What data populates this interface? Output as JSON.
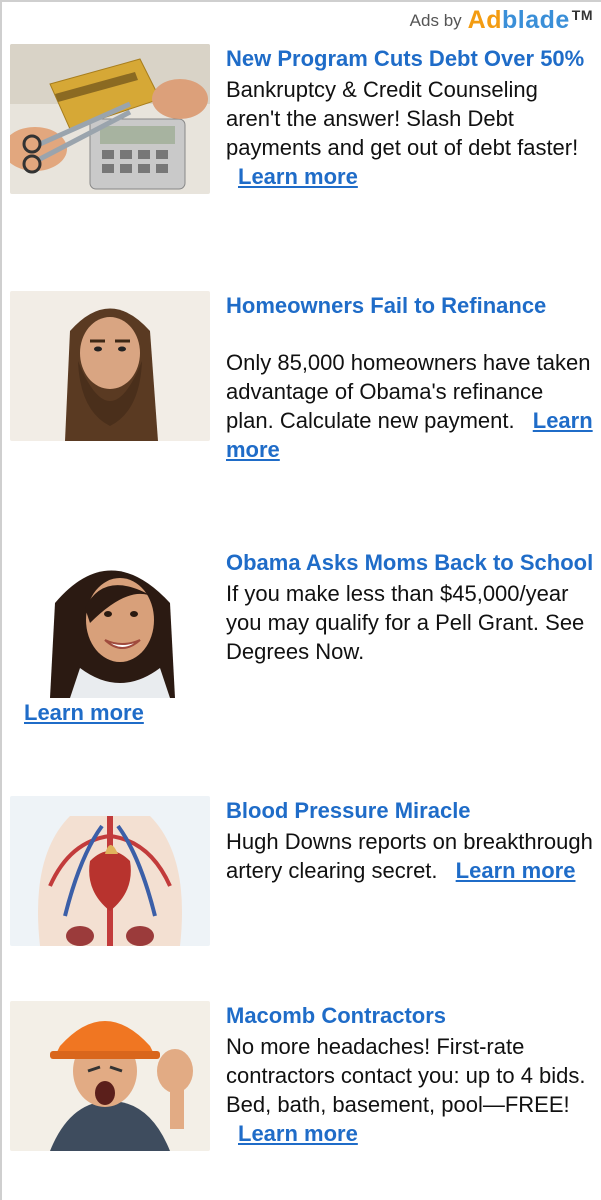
{
  "header": {
    "ads_by": "Ads by",
    "brand_part1": "Ad",
    "brand_part2": "blade",
    "trademark": "TM"
  },
  "ads": [
    {
      "title": "New Program Cuts Debt Over 50%",
      "description": "Bankruptcy & Credit Counseling aren't the answer! Slash Debt payments and get out of debt faster!",
      "learn": "Learn more",
      "image_icon": "credit-card-scissors-icon"
    },
    {
      "title": "Homeowners Fail to Refinance",
      "description": "Only 85,000 homeowners have taken advantage of Obama's refinance plan. Calculate new payment.",
      "learn": "Learn more",
      "image_icon": "bearded-man-portrait-icon"
    },
    {
      "title": "Obama Asks Moms Back to School",
      "description": "If you make less than $45,000/year you may qualify for a Pell Grant. See Degrees Now.",
      "learn": "Learn more",
      "image_icon": "smiling-woman-portrait-icon"
    },
    {
      "title": "Blood Pressure Miracle",
      "description": "Hugh Downs reports on breakthrough artery clearing secret.",
      "learn": "Learn more",
      "image_icon": "heart-arteries-icon"
    },
    {
      "title": "Macomb Contractors",
      "description": "No more headaches! First-rate contractors contact you: up to 4 bids. Bed, bath, basement, pool—FREE!",
      "learn": "Learn more",
      "image_icon": "contractor-hardhat-icon"
    }
  ],
  "colors": {
    "link": "#1f6cc8",
    "brand_orange": "#f39c12",
    "brand_blue": "#3a8fd8"
  }
}
